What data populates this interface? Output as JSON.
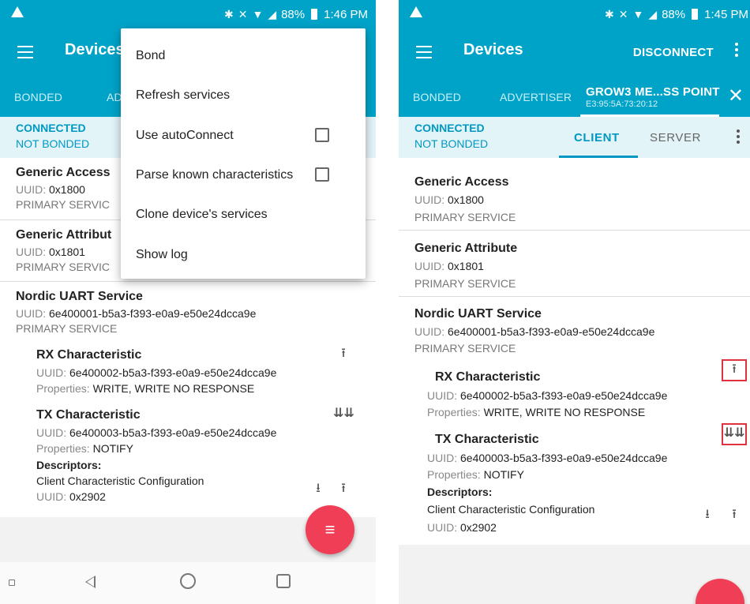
{
  "left": {
    "status": {
      "battery": "88%",
      "time": "1:46 PM"
    },
    "appbar": {
      "title": "Devices"
    },
    "tabs": [
      {
        "label": "BONDED"
      },
      {
        "label": "AD"
      }
    ],
    "connection": {
      "state": "CONNECTED",
      "bond": "NOT BONDED"
    },
    "services": [
      {
        "name": "Generic Access",
        "uuid_label": "UUID:",
        "uuid": "0x1800",
        "type": "PRIMARY SERVIC"
      },
      {
        "name": "Generic Attribut",
        "uuid_label": "UUID:",
        "uuid": "0x1801",
        "type": "PRIMARY SERVIC"
      },
      {
        "name": "Nordic UART Service",
        "uuid_label": "UUID:",
        "uuid": "6e400001-b5a3-f393-e0a9-e50e24dcca9e",
        "type": "PRIMARY SERVICE"
      }
    ],
    "characteristics": [
      {
        "name": "RX Characteristic",
        "uuid_label": "UUID:",
        "uuid": "6e400002-b5a3-f393-e0a9-e50e24dcca9e",
        "props_label": "Properties:",
        "props": "WRITE, WRITE NO RESPONSE"
      },
      {
        "name": "TX Characteristic",
        "uuid_label": "UUID:",
        "uuid": "6e400003-b5a3-f393-e0a9-e50e24dcca9e",
        "props_label": "Properties:",
        "props": "NOTIFY"
      }
    ],
    "descriptors": {
      "label": "Descriptors:",
      "name": "Client Characteristic Configuration",
      "uuid_label": "UUID:",
      "uuid": "0x2902"
    },
    "menu": {
      "items": [
        {
          "label": "Bond"
        },
        {
          "label": "Refresh services"
        },
        {
          "label": "Use autoConnect"
        },
        {
          "label": "Parse known characteristics"
        },
        {
          "label": "Clone device's services"
        },
        {
          "label": "Show log"
        }
      ]
    }
  },
  "right": {
    "status": {
      "battery": "88%",
      "time": "1:45 PM"
    },
    "appbar": {
      "title": "Devices",
      "action": "DISCONNECT"
    },
    "tabs": [
      {
        "label": "BONDED"
      },
      {
        "label": "ADVERTISER"
      },
      {
        "label": "GROW3 ME...SS POINT",
        "sub": "E3:95:5A:73:20:12"
      }
    ],
    "connection": {
      "state": "CONNECTED",
      "bond": "NOT BONDED"
    },
    "subtabs": [
      {
        "label": "CLIENT"
      },
      {
        "label": "SERVER"
      }
    ],
    "services": [
      {
        "name": "Generic Access",
        "uuid_label": "UUID:",
        "uuid": "0x1800",
        "type": "PRIMARY SERVICE"
      },
      {
        "name": "Generic Attribute",
        "uuid_label": "UUID:",
        "uuid": "0x1801",
        "type": "PRIMARY SERVICE"
      },
      {
        "name": "Nordic UART Service",
        "uuid_label": "UUID:",
        "uuid": "6e400001-b5a3-f393-e0a9-e50e24dcca9e",
        "type": "PRIMARY SERVICE"
      }
    ],
    "characteristics": [
      {
        "name": "RX Characteristic",
        "uuid_label": "UUID:",
        "uuid": "6e400002-b5a3-f393-e0a9-e50e24dcca9e",
        "props_label": "Properties:",
        "props": "WRITE, WRITE NO RESPONSE"
      },
      {
        "name": "TX Characteristic",
        "uuid_label": "UUID:",
        "uuid": "6e400003-b5a3-f393-e0a9-e50e24dcca9e",
        "props_label": "Properties:",
        "props": "NOTIFY"
      }
    ],
    "descriptors": {
      "label": "Descriptors:",
      "name": "Client Characteristic Configuration",
      "uuid_label": "UUID:",
      "uuid": "0x2902"
    }
  },
  "theme": {
    "primary": "#00a3c8",
    "accent": "#ef3e55",
    "highlight": "#e0313f"
  },
  "icons": {
    "write": "upload-arrow-icon",
    "notify": "notify-arrows-icon",
    "read": "download-arrow-icon",
    "fab": "log-list-icon"
  }
}
